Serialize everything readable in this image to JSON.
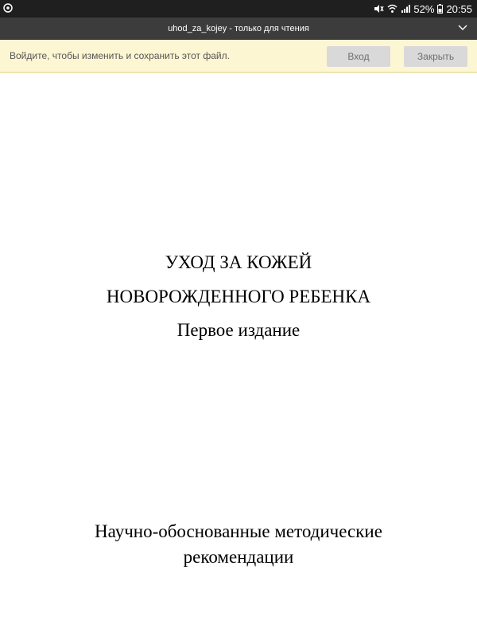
{
  "status_bar": {
    "battery_percent": "52%",
    "time": "20:55",
    "icons": [
      "app-notification-icon",
      "mute-icon",
      "wifi-icon",
      "signal-icon",
      "battery-icon"
    ]
  },
  "title_bar": {
    "title": "uhod_za_kojey - только для чтения"
  },
  "info_bar": {
    "message": "Войдите, чтобы изменить и сохранить этот файл.",
    "login_label": "Вход",
    "close_label": "Закрыть"
  },
  "document": {
    "title_line1": "УХОД ЗА КОЖЕЙ",
    "title_line2": "НОВОРОЖДЕННОГО РЕБЕНКА",
    "edition": "Первое издание",
    "subtitle_line1": "Научно-обоснованные методические",
    "subtitle_line2": "рекомендации"
  },
  "colors": {
    "status_bar_bg": "#1f1f1f",
    "title_bar_bg": "#3c3c3c",
    "info_bar_bg": "#fdf6d2",
    "button_bg": "#d9d9d9"
  }
}
